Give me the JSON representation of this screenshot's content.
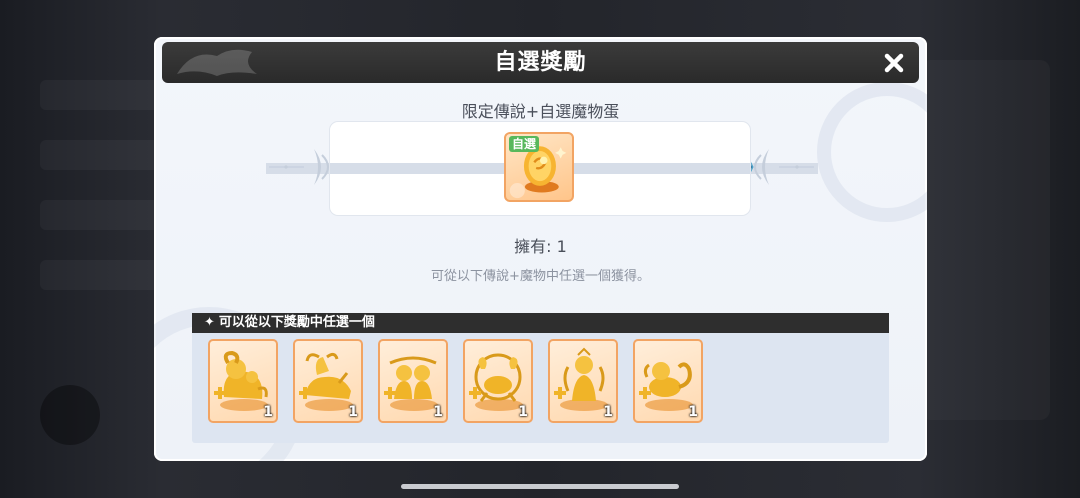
{
  "dialog": {
    "title": "自選獎勵",
    "close_icon": "close-icon"
  },
  "egg": {
    "title": "限定傳說+自選魔物蛋",
    "tag": "自選",
    "owned": "擁有: 1",
    "hint": "可從以下傳說+魔物中任選一個獲得。"
  },
  "rewards": {
    "header": "可以從以下獎勵中任選一個",
    "items": [
      {
        "name": "golden-ram-statue",
        "count": "1"
      },
      {
        "name": "golden-bull-statue",
        "count": "1"
      },
      {
        "name": "golden-twins-statue",
        "count": "1"
      },
      {
        "name": "golden-crab-statue",
        "count": "1"
      },
      {
        "name": "golden-maiden-statue",
        "count": "1"
      },
      {
        "name": "golden-scorpion-statue",
        "count": "1"
      }
    ]
  },
  "colors": {
    "header_bg": "#2e2e2e",
    "card_border": "#f2a463",
    "gold": "#f0b428",
    "tag_green": "#58b85c"
  }
}
